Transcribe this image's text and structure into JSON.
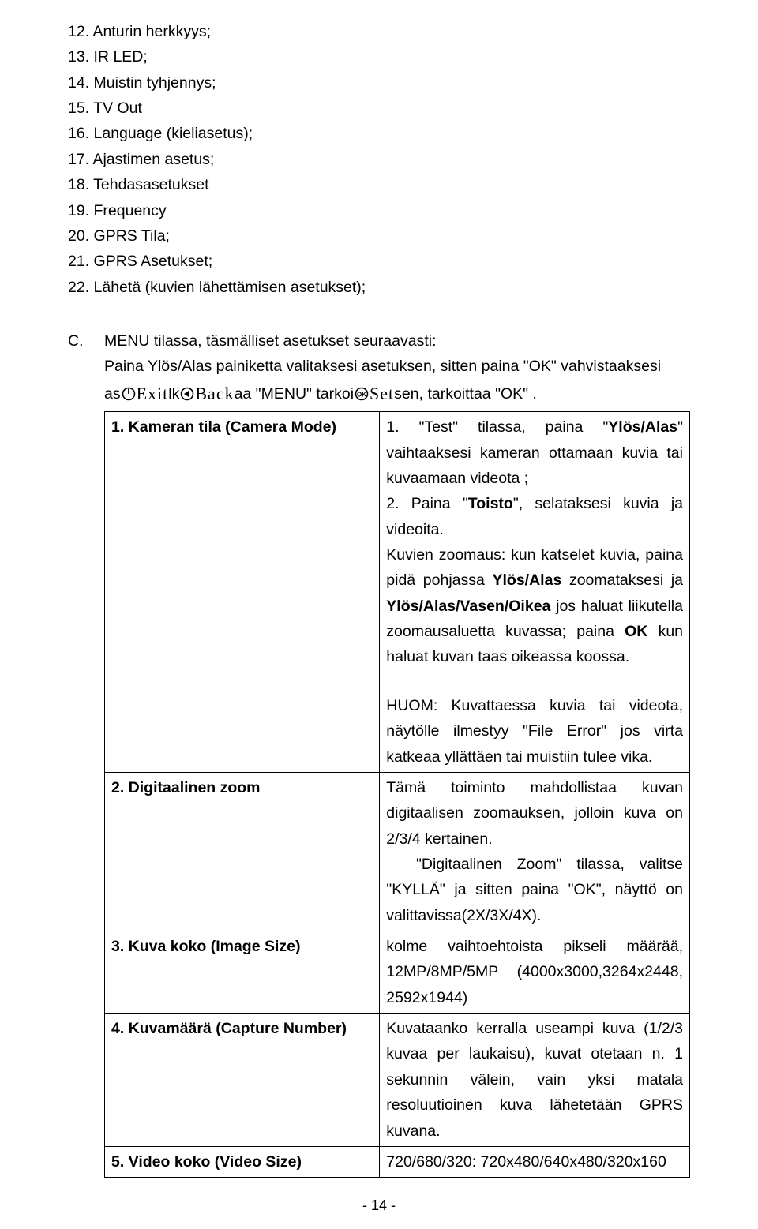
{
  "list": {
    "i12": "12. Anturin herkkyys;",
    "i13": "13. IR LED;",
    "i14": "14. Muistin tyhjennys;",
    "i15": "15. TV Out",
    "i16": "16. Language (kieliasetus);",
    "i17": "17. Ajastimen asetus;",
    "i18": "18. Tehdasasetukset",
    "i19": "19. Frequency",
    "i20": "20. GPRS Tila;",
    "i21": "21. GPRS Asetukset;",
    "i22": "22. Lähetä (kuvien lähettämisen asetukset);"
  },
  "sectionC": {
    "letter": "C.",
    "line1": "MENU tilassa, täsmälliset asetukset seuraavasti:",
    "line2_full": "Paina Ylös/Alas painiketta valitaksesi asetuksen, sitten paina \"OK\" vahvistaaksesi",
    "line3": {
      "pre": "as",
      "exit_word": "Exit",
      "mid1": "lk",
      "back_word": "Back",
      "mid2": "aa \"MENU\" tarkoi",
      "set_word": "Set",
      "post": "sen, tarkoittaa \"OK\" ."
    }
  },
  "table": {
    "r1": {
      "left": "1. Kameran tila (Camera Mode)",
      "right": "1. \"Test\" tilassa, paina \"Ylös/Alas\" vaihtaaksesi kameran ottamaan kuvia tai kuvaamaan videota ;\n2. Paina \"Toisto\", selataksesi kuvia ja videoita.\nKuvien zoomaus: kun katselet kuvia, paina pidä pohjassa Ylös/Alas zoomataksesi ja Ylös/Alas/Vasen/Oikea jos haluat liikutella zoomausaluetta kuvassa; paina OK kun haluat kuvan taas oikeassa koossa."
    },
    "r2note": "HUOM: Kuvattaessa kuvia tai videota, näytölle ilmestyy \"File Error\" jos virta katkeaa yllättäen tai muistiin tulee vika.",
    "r2": {
      "left": "2. Digitaalinen zoom",
      "right": "Tämä toiminto mahdollistaa kuvan digitaalisen zoomauksen, jolloin kuva on 2/3/4 kertainen.\n  \"Digitaalinen Zoom\" tilassa, valitse \"KYLLÄ\" ja sitten paina \"OK\", näyttö on valittavissa(2X/3X/4X)."
    },
    "r3": {
      "left": "3. Kuva koko (Image Size)",
      "right": "kolme vaihtoehtoista pikseli määrää, 12MP/8MP/5MP (4000x3000,3264x2448, 2592x1944)"
    },
    "r4": {
      "left": "4. Kuvamäärä (Capture Number)",
      "right": "Kuvataanko kerralla  useampi kuva (1/2/3 kuvaa per laukaisu), kuvat otetaan n. 1 sekunnin välein, vain yksi matala resoluutioinen kuva lähetetään GPRS kuvana."
    },
    "r5": {
      "left": "5. Video koko (Video Size)",
      "right": "720/680/320: 720x480/640x480/320x160"
    }
  },
  "footer": "- 14 -"
}
